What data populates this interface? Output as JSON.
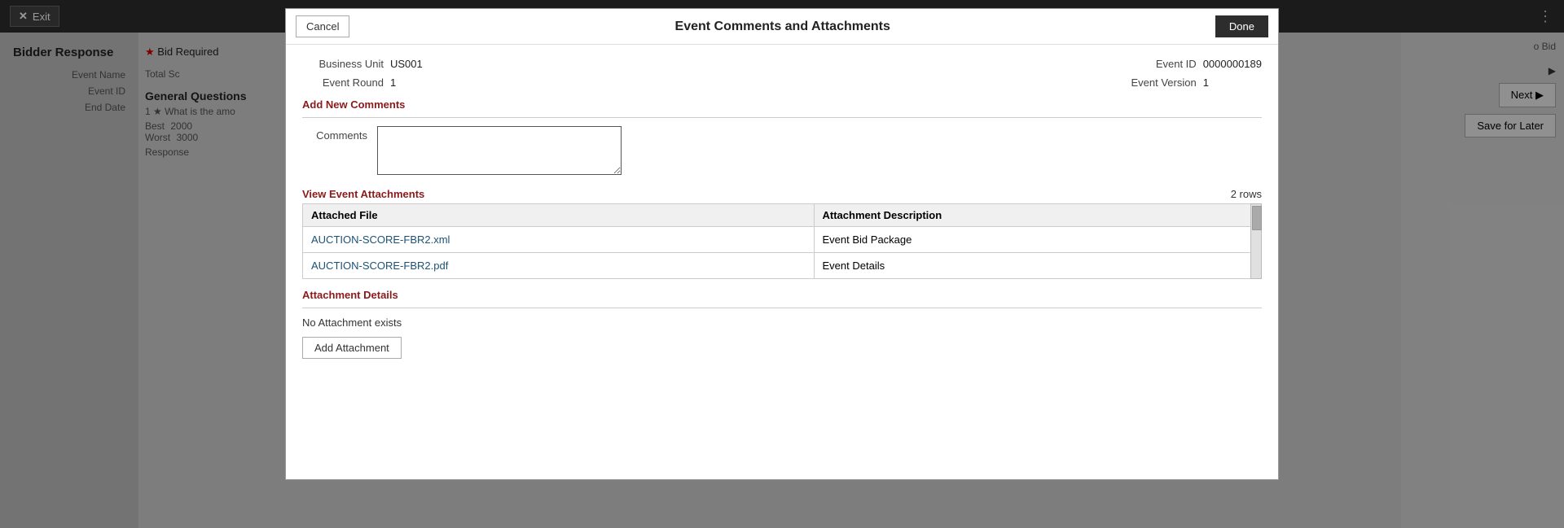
{
  "topBar": {
    "exitLabel": "Exit",
    "menuIcon": "⋮"
  },
  "bgPage": {
    "title": "Bidder Response",
    "labels": {
      "eventName": "Event Name",
      "eventId": "Event ID",
      "endDate": "End Date"
    },
    "bidRequired": "Bid Required",
    "totalScoreLabel": "Total Sc",
    "generalQuestions": "General Questions",
    "question1": "1 ★ What is the amo",
    "best": "Best",
    "bestValue": "2000",
    "worst": "Worst",
    "worstValue": "3000",
    "response": "Response",
    "toBid": "o Bid",
    "nextLabel": "Next ▶",
    "saveForLaterLabel": "Save for Later"
  },
  "modal": {
    "title": "Event Comments and Attachments",
    "cancelLabel": "Cancel",
    "doneLabel": "Done",
    "businessUnitLabel": "Business Unit",
    "businessUnitValue": "US001",
    "eventIdLabel": "Event ID",
    "eventIdValue": "0000000189",
    "eventRoundLabel": "Event Round",
    "eventRoundValue": "1",
    "eventVersionLabel": "Event Version",
    "eventVersionValue": "1",
    "addNewCommentsHeading": "Add New Comments",
    "commentsLabel": "Comments",
    "commentsPlaceholder": "",
    "viewEventAttachmentsHeading": "View Event Attachments",
    "rowsCount": "2 rows",
    "tableHeaders": {
      "attachedFile": "Attached File",
      "attachmentDescription": "Attachment Description"
    },
    "attachments": [
      {
        "file": "AUCTION-SCORE-FBR2.xml",
        "description": "Event Bid Package"
      },
      {
        "file": "AUCTION-SCORE-FBR2.pdf",
        "description": "Event Details"
      }
    ],
    "attachmentDetailsHeading": "Attachment Details",
    "noAttachmentText": "No Attachment exists",
    "addAttachmentLabel": "Add Attachment"
  }
}
